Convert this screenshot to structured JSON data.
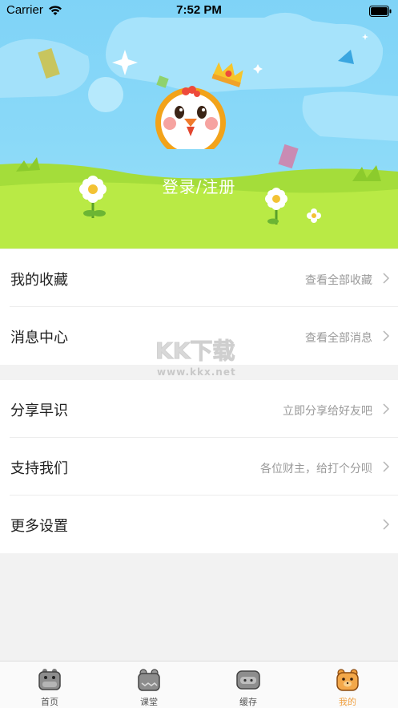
{
  "status_bar": {
    "carrier": "Carrier",
    "time": "7:52 PM"
  },
  "header": {
    "login_label": "登录/注册"
  },
  "sections": [
    {
      "rows": [
        {
          "title": "我的收藏",
          "hint": "查看全部收藏",
          "icon": "chevron-right-icon"
        },
        {
          "title": "消息中心",
          "hint": "查看全部消息",
          "icon": "chevron-right-icon"
        }
      ]
    },
    {
      "rows": [
        {
          "title": "分享早识",
          "hint": "立即分享给好友吧",
          "icon": "chevron-right-icon"
        },
        {
          "title": "支持我们",
          "hint": "各位财主，给打个分呗",
          "icon": "chevron-right-icon"
        },
        {
          "title": "更多设置",
          "hint": "",
          "icon": "chevron-right-icon"
        }
      ]
    }
  ],
  "watermark": {
    "brand": "KK下载",
    "url": "www.kkx.net"
  },
  "tabbar": {
    "active_color": "#f0a040",
    "tabs": [
      {
        "label": "首页",
        "icon": "hippo-face-icon"
      },
      {
        "label": "课堂",
        "icon": "frog-face-icon"
      },
      {
        "label": "缓存",
        "icon": "pig-face-icon"
      },
      {
        "label": "我的",
        "icon": "bear-face-icon"
      }
    ]
  }
}
